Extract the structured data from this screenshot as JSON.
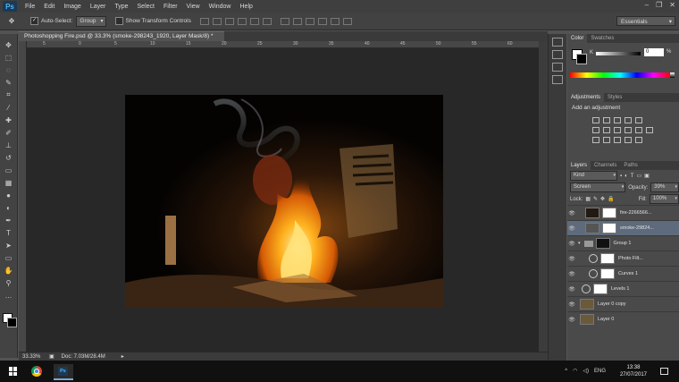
{
  "app": {
    "logo": "Ps",
    "menu": [
      "File",
      "Edit",
      "Image",
      "Layer",
      "Type",
      "Select",
      "Filter",
      "View",
      "Window",
      "Help"
    ],
    "window_controls": [
      "–",
      "❐",
      "✕"
    ]
  },
  "options": {
    "auto_select_label": "Auto-Select:",
    "auto_select_value": "Group",
    "show_transform_label": "Show Transform Controls",
    "workspace": "Essentials"
  },
  "document": {
    "tab_title": "Photoshopping Fire.psd @ 33.3% (smoke-298243_1920, Layer Mask/8) *",
    "zoom": "33.33%",
    "doc_size": "Doc: 7.03M/28.4M",
    "ruler_numbers": [
      "5",
      "0",
      "5",
      "10",
      "15",
      "20",
      "25",
      "30",
      "35",
      "40",
      "45",
      "50",
      "55",
      "60"
    ]
  },
  "colors": {
    "accent": "#5d6b7c",
    "canvas_bg": "#282828"
  },
  "color_panel": {
    "tabs": [
      "Color",
      "Swatches"
    ],
    "channel": "K",
    "value": "0",
    "unit": "%"
  },
  "adjustments": {
    "tabs": [
      "Adjustments",
      "Styles"
    ],
    "title": "Add an adjustment"
  },
  "layers": {
    "tabs": [
      "Layers",
      "Channels",
      "Paths"
    ],
    "kind_label": "Kind",
    "blend_mode": "Screen",
    "opacity_label": "Opacity:",
    "opacity_value": "39%",
    "lock_label": "Lock:",
    "fill_label": "Fill:",
    "fill_value": "100%",
    "items": [
      {
        "name": "fire-2266566...",
        "type": "masked",
        "selected": false
      },
      {
        "name": "smoke-29824...",
        "type": "masked",
        "selected": true
      },
      {
        "name": "Group 1",
        "type": "group",
        "selected": false
      },
      {
        "name": "Photo Filt...",
        "type": "adjustment",
        "selected": false
      },
      {
        "name": "Curves 1",
        "type": "adjustment",
        "selected": false
      },
      {
        "name": "Levels 1",
        "type": "adjustment",
        "selected": false
      },
      {
        "name": "Layer 0 copy",
        "type": "image",
        "selected": false
      },
      {
        "name": "Layer 0",
        "type": "image",
        "selected": false
      }
    ]
  },
  "taskbar": {
    "tray_lang": "ENG",
    "time": "13:38",
    "date": "27/07/2017"
  }
}
